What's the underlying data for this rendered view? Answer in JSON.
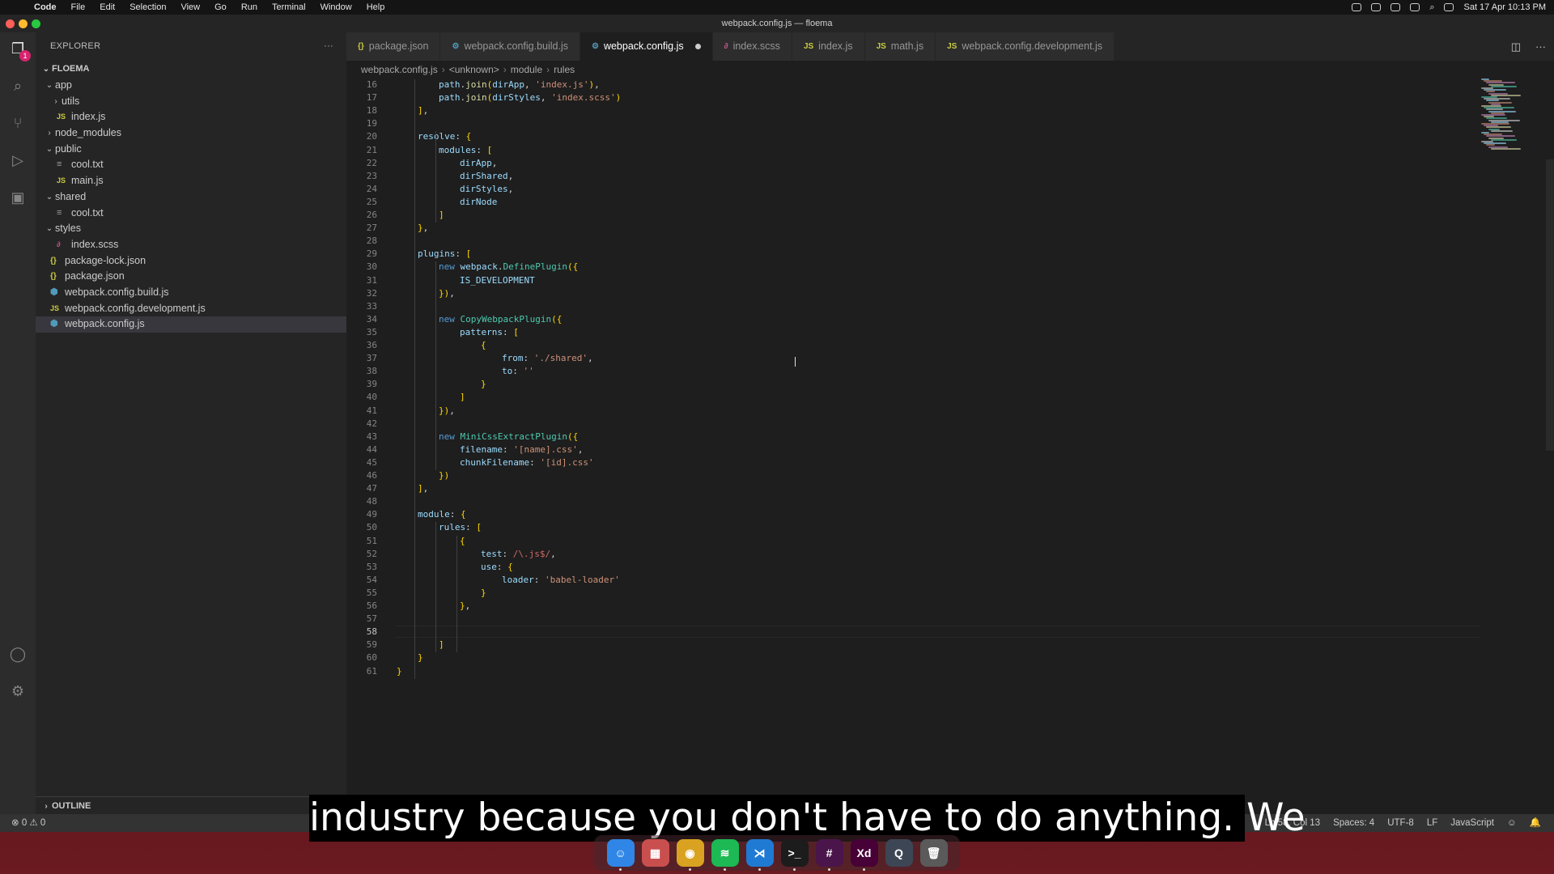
{
  "menubar": {
    "apple": "",
    "items": [
      "Code",
      "File",
      "Edit",
      "Selection",
      "View",
      "Go",
      "Run",
      "Terminal",
      "Window",
      "Help"
    ],
    "clock": "Sat 17 Apr  10:13 PM"
  },
  "window": {
    "title": "webpack.config.js — floema"
  },
  "activity": {
    "badge": "1",
    "icons": [
      "files-icon",
      "search-icon",
      "source-control-icon",
      "run-debug-icon",
      "extensions-icon",
      "account-icon",
      "settings-gear-icon"
    ]
  },
  "sidebar": {
    "title": "EXPLORER",
    "root": "FLOEMA",
    "tree": [
      {
        "label": "app",
        "depth": 1,
        "kind": "folder-open"
      },
      {
        "label": "utils",
        "depth": 2,
        "kind": "folder-closed"
      },
      {
        "label": "index.js",
        "depth": 2,
        "kind": "js"
      },
      {
        "label": "node_modules",
        "depth": 1,
        "kind": "folder-closed"
      },
      {
        "label": "public",
        "depth": 1,
        "kind": "folder-open"
      },
      {
        "label": "cool.txt",
        "depth": 2,
        "kind": "txt"
      },
      {
        "label": "main.js",
        "depth": 2,
        "kind": "js"
      },
      {
        "label": "shared",
        "depth": 1,
        "kind": "folder-open"
      },
      {
        "label": "cool.txt",
        "depth": 2,
        "kind": "txt"
      },
      {
        "label": "styles",
        "depth": 1,
        "kind": "folder-open"
      },
      {
        "label": "index.scss",
        "depth": 2,
        "kind": "scss"
      },
      {
        "label": "package-lock.json",
        "depth": 1,
        "kind": "json"
      },
      {
        "label": "package.json",
        "depth": 1,
        "kind": "json"
      },
      {
        "label": "webpack.config.build.js",
        "depth": 1,
        "kind": "webpack"
      },
      {
        "label": "webpack.config.development.js",
        "depth": 1,
        "kind": "js"
      },
      {
        "label": "webpack.config.js",
        "depth": 1,
        "kind": "webpack",
        "selected": true
      }
    ],
    "outline": "OUTLINE"
  },
  "tabs": [
    {
      "label": "package.json",
      "icon": "{}",
      "kind": "json"
    },
    {
      "label": "webpack.config.build.js",
      "icon": "⚙",
      "kind": "webpack"
    },
    {
      "label": "webpack.config.js",
      "icon": "⚙",
      "kind": "webpack",
      "active": true,
      "dirty": true
    },
    {
      "label": "index.scss",
      "icon": "∂",
      "kind": "scss"
    },
    {
      "label": "index.js",
      "icon": "JS",
      "kind": "js"
    },
    {
      "label": "math.js",
      "icon": "JS",
      "kind": "js"
    },
    {
      "label": "webpack.config.development.js",
      "icon": "JS",
      "kind": "js"
    }
  ],
  "breadcrumb": [
    "webpack.config.js",
    "<unknown>",
    "module",
    "rules"
  ],
  "code": {
    "current_line": 58,
    "lines": [
      {
        "n": 16,
        "indent": 2,
        "text": "path.join(dirApp, 'index.js'),"
      },
      {
        "n": 17,
        "indent": 2,
        "text": "path.join(dirStyles, 'index.scss')"
      },
      {
        "n": 18,
        "indent": 1,
        "text": "],"
      },
      {
        "n": 19,
        "indent": 0,
        "text": ""
      },
      {
        "n": 20,
        "indent": 1,
        "text": "resolve: {"
      },
      {
        "n": 21,
        "indent": 2,
        "text": "modules: ["
      },
      {
        "n": 22,
        "indent": 3,
        "text": "dirApp,"
      },
      {
        "n": 23,
        "indent": 3,
        "text": "dirShared,"
      },
      {
        "n": 24,
        "indent": 3,
        "text": "dirStyles,"
      },
      {
        "n": 25,
        "indent": 3,
        "text": "dirNode"
      },
      {
        "n": 26,
        "indent": 2,
        "text": "]"
      },
      {
        "n": 27,
        "indent": 1,
        "text": "},"
      },
      {
        "n": 28,
        "indent": 0,
        "text": ""
      },
      {
        "n": 29,
        "indent": 1,
        "text": "plugins: ["
      },
      {
        "n": 30,
        "indent": 2,
        "text": "new webpack.DefinePlugin({"
      },
      {
        "n": 31,
        "indent": 3,
        "text": "IS_DEVELOPMENT"
      },
      {
        "n": 32,
        "indent": 2,
        "text": "}),"
      },
      {
        "n": 33,
        "indent": 0,
        "text": ""
      },
      {
        "n": 34,
        "indent": 2,
        "text": "new CopyWebpackPlugin({"
      },
      {
        "n": 35,
        "indent": 3,
        "text": "patterns: ["
      },
      {
        "n": 36,
        "indent": 4,
        "text": "{"
      },
      {
        "n": 37,
        "indent": 5,
        "text": "from: './shared',"
      },
      {
        "n": 38,
        "indent": 5,
        "text": "to: ''"
      },
      {
        "n": 39,
        "indent": 4,
        "text": "}"
      },
      {
        "n": 40,
        "indent": 3,
        "text": "]"
      },
      {
        "n": 41,
        "indent": 2,
        "text": "}),"
      },
      {
        "n": 42,
        "indent": 0,
        "text": ""
      },
      {
        "n": 43,
        "indent": 2,
        "text": "new MiniCssExtractPlugin({"
      },
      {
        "n": 44,
        "indent": 3,
        "text": "filename: '[name].css',"
      },
      {
        "n": 45,
        "indent": 3,
        "text": "chunkFilename: '[id].css'"
      },
      {
        "n": 46,
        "indent": 2,
        "text": "})"
      },
      {
        "n": 47,
        "indent": 1,
        "text": "],"
      },
      {
        "n": 48,
        "indent": 0,
        "text": ""
      },
      {
        "n": 49,
        "indent": 1,
        "text": "module: {"
      },
      {
        "n": 50,
        "indent": 2,
        "text": "rules: ["
      },
      {
        "n": 51,
        "indent": 3,
        "text": "{"
      },
      {
        "n": 52,
        "indent": 4,
        "text": "test: /\\.js$/,"
      },
      {
        "n": 53,
        "indent": 4,
        "text": "use: {"
      },
      {
        "n": 54,
        "indent": 5,
        "text": "loader: 'babel-loader'"
      },
      {
        "n": 55,
        "indent": 4,
        "text": "}"
      },
      {
        "n": 56,
        "indent": 3,
        "text": "},"
      },
      {
        "n": 57,
        "indent": 0,
        "text": ""
      },
      {
        "n": 58,
        "indent": 0,
        "text": ""
      },
      {
        "n": 59,
        "indent": 2,
        "text": "]"
      },
      {
        "n": 60,
        "indent": 1,
        "text": "}"
      },
      {
        "n": 61,
        "indent": 0,
        "text": "}"
      }
    ]
  },
  "statusbar": {
    "problems": "⊗ 0  ⚠ 0",
    "position": "Ln 58, Col 13",
    "spaces": "Spaces: 4",
    "encoding": "UTF-8",
    "eol": "LF",
    "language": "JavaScript"
  },
  "subtitle": "industry because you don't have to do anything. We",
  "dock": [
    {
      "name": "finder-icon",
      "label": "☺",
      "color": "#2f86e6"
    },
    {
      "name": "launchpad-icon",
      "label": "▦",
      "color": "#c94f4f"
    },
    {
      "name": "chrome-icon",
      "label": "◉",
      "color": "#d9a221"
    },
    {
      "name": "spotify-icon",
      "label": "≋",
      "color": "#1db954"
    },
    {
      "name": "vscode-icon",
      "label": "⋊",
      "color": "#1f7ad3"
    },
    {
      "name": "terminal-icon",
      "label": ">_",
      "color": "#1c1c1c"
    },
    {
      "name": "slack-icon",
      "label": "#",
      "color": "#4a154b"
    },
    {
      "name": "adobe-xd-icon",
      "label": "Xd",
      "color": "#470137"
    },
    {
      "name": "quicktime-icon",
      "label": "Q",
      "color": "#3c4654"
    },
    {
      "name": "trash-icon",
      "label": "🗑",
      "color": "#5a5a5a"
    }
  ]
}
